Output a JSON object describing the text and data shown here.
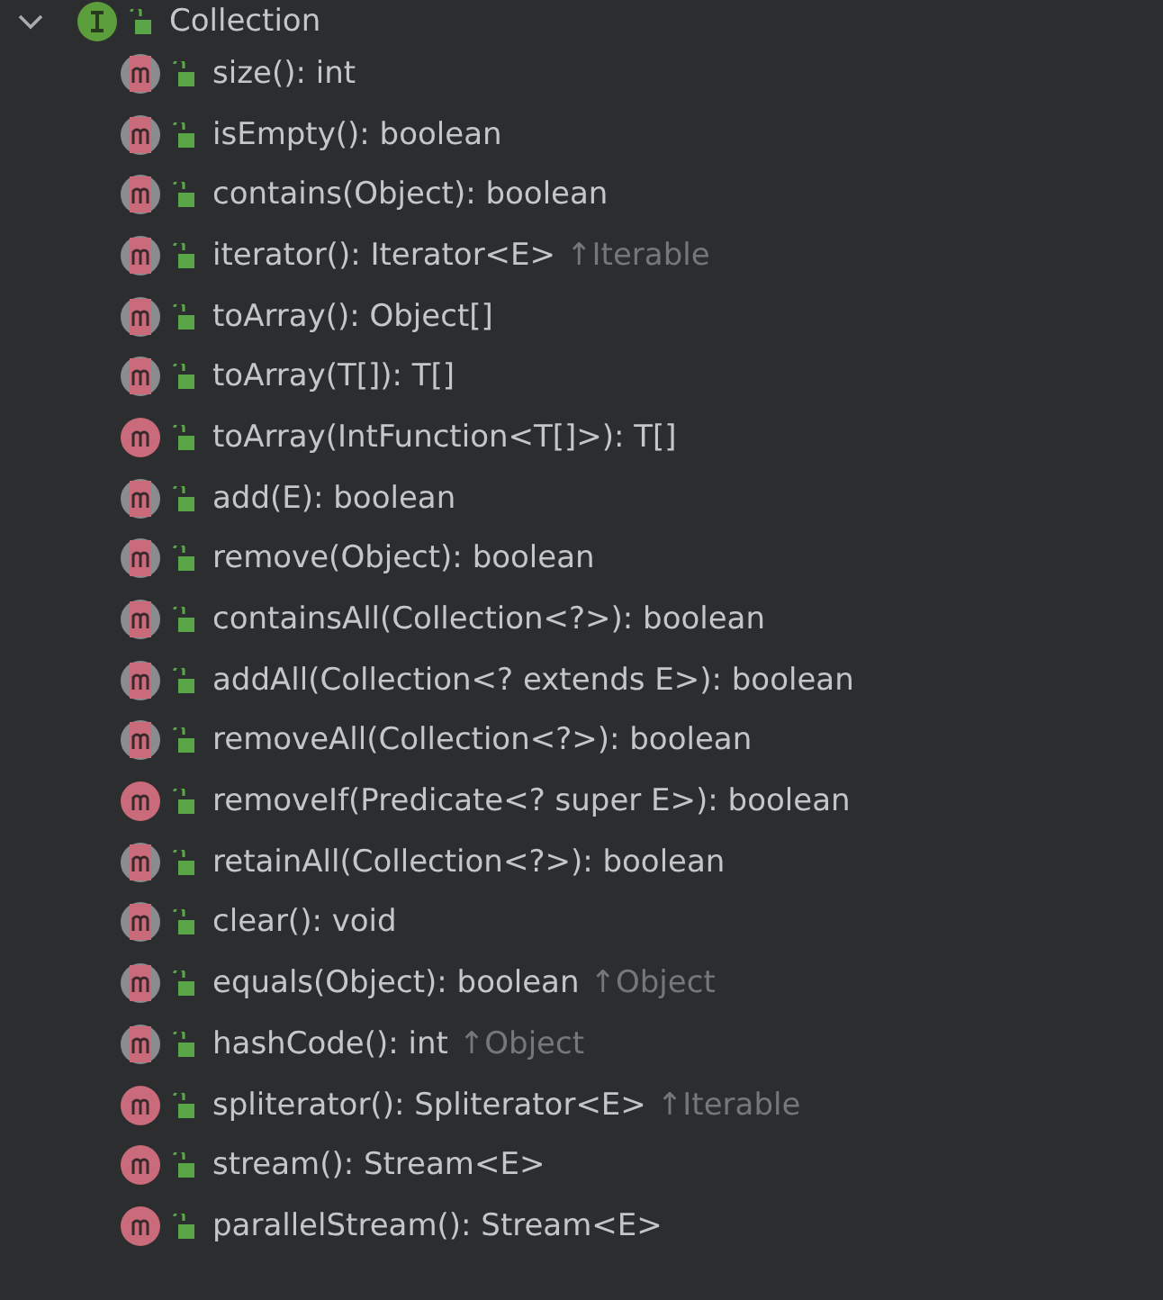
{
  "tree": {
    "label": "Collection",
    "expanded": true,
    "kind": "interface",
    "children": [
      {
        "label": "size(): int",
        "kind": "abstract"
      },
      {
        "label": "isEmpty(): boolean",
        "kind": "abstract"
      },
      {
        "label": "contains(Object): boolean",
        "kind": "abstract"
      },
      {
        "label": "iterator(): Iterator<E>",
        "kind": "abstract",
        "inherited": "↑Iterable"
      },
      {
        "label": "toArray(): Object[]",
        "kind": "abstract"
      },
      {
        "label": "toArray(T[]): T[]",
        "kind": "abstract"
      },
      {
        "label": "toArray(IntFunction<T[]>): T[]",
        "kind": "default"
      },
      {
        "label": "add(E): boolean",
        "kind": "abstract"
      },
      {
        "label": "remove(Object): boolean",
        "kind": "abstract"
      },
      {
        "label": "containsAll(Collection<?>): boolean",
        "kind": "abstract"
      },
      {
        "label": "addAll(Collection<? extends E>): boolean",
        "kind": "abstract"
      },
      {
        "label": "removeAll(Collection<?>): boolean",
        "kind": "abstract"
      },
      {
        "label": "removeIf(Predicate<? super E>): boolean",
        "kind": "default"
      },
      {
        "label": "retainAll(Collection<?>): boolean",
        "kind": "abstract"
      },
      {
        "label": "clear(): void",
        "kind": "abstract"
      },
      {
        "label": "equals(Object): boolean",
        "kind": "abstract",
        "inherited": "↑Object"
      },
      {
        "label": "hashCode(): int",
        "kind": "abstract",
        "inherited": "↑Object"
      },
      {
        "label": "spliterator(): Spliterator<E>",
        "kind": "default",
        "inherited": "↑Iterable"
      },
      {
        "label": "stream(): Stream<E>",
        "kind": "default"
      },
      {
        "label": "parallelStream(): Stream<E>",
        "kind": "default"
      }
    ]
  }
}
